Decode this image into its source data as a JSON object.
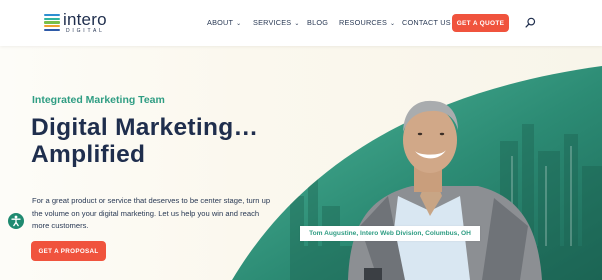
{
  "brand": {
    "name": "intero",
    "sub": "DIGITAL"
  },
  "nav": {
    "about": "ABOUT",
    "services": "SERVICES",
    "blog": "BLOG",
    "resources": "RESOURCES",
    "contact": "CONTACT US",
    "cta": "GET A QUOTE"
  },
  "hero": {
    "eyebrow": "Integrated Marketing Team",
    "headline_line1": "Digital Marketing…",
    "headline_line2": "Amplified",
    "body": "For a great product or service that deserves to be center stage, turn up the volume on your digital marketing. Let us help you win and reach more customers.",
    "cta": "GET A PROPOSAL",
    "caption": "Tom Augustine, Intero Web Division, Columbus, OH"
  },
  "colors": {
    "brand_navy": "#1f2e4d",
    "accent_green": "#2f9d83",
    "cta_orange": "#f0533d"
  },
  "icons": [
    "chevron-down-icon",
    "search-icon",
    "accessibility-icon"
  ]
}
